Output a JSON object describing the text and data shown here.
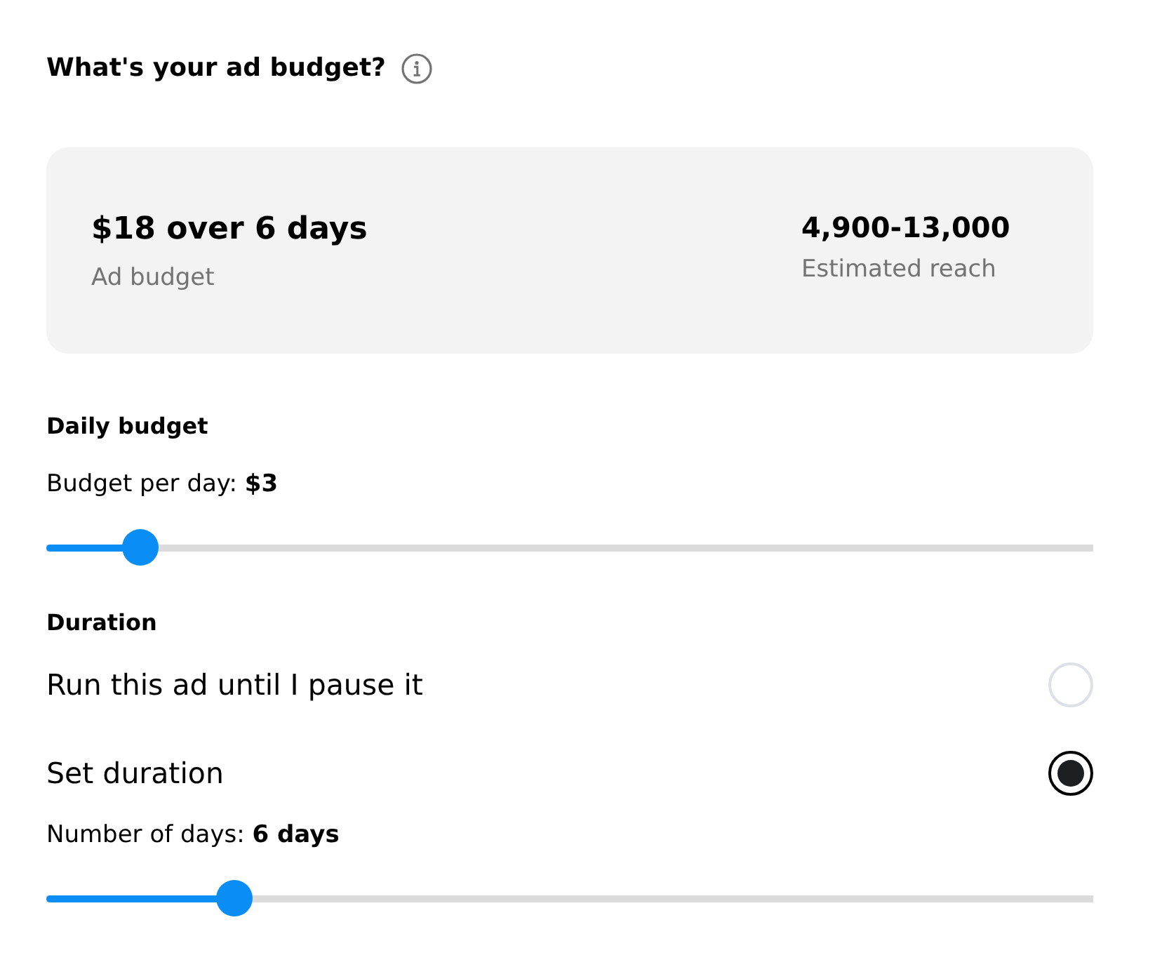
{
  "heading": {
    "title": "What's your ad budget?"
  },
  "summary": {
    "budget": "$18 over 6 days",
    "budget_label": "Ad budget",
    "reach": "4,900-13,000",
    "reach_label": "Estimated reach"
  },
  "daily_budget": {
    "title": "Daily budget",
    "reading": "Budget per day: **$3**",
    "level": 0.09
  },
  "duration": {
    "title": "Duration",
    "options": [
      {
        "label": "Run this ad until I pause it",
        "selected": false
      },
      {
        "label": "Set duration",
        "selected": true
      }
    ],
    "reading": "Number of days: **6 days**",
    "level": 0.18
  }
}
